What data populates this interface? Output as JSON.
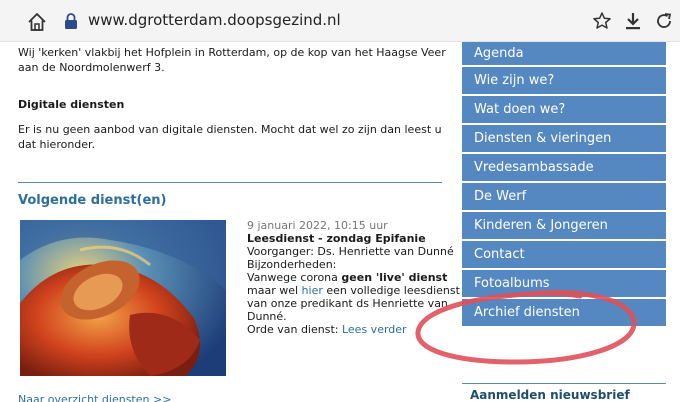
{
  "browser": {
    "url": "www.dgrotterdam.doopsgezind.nl"
  },
  "main": {
    "intro_text": "Wij 'kerken' vlakbij het Hofplein in Rotterdam, op de kop van het Haagse Veer aan de Noordmolenwerf 3.",
    "digital_title": "Digitale diensten",
    "digital_text": "Er is nu geen aanbod van digitale diensten. Mocht dat wel zo zijn dan leest u dat hieronder.",
    "next_title": "Volgende dienst(en)",
    "event": {
      "date": "9 januari 2022, 10:15 uur",
      "title": "Leesdienst - zondag Epifanie",
      "voorganger": "Voorganger: Ds. Henriette van Dunné",
      "bijzonderheden": "Bijzonderheden:",
      "line1_pre": "Vanwege corona ",
      "line1_bold": "geen 'live' dienst",
      "line2_pre": "maar wel ",
      "line2_link": "hier",
      "line2_post": " een volledige leesdienst",
      "line3": "van onze predikant ds Henriette van",
      "line4": "Dunné.",
      "order_pre": "Orde van dienst: ",
      "order_link": "Lees verder"
    },
    "overview_link": "Naar overzicht diensten >>"
  },
  "nav": {
    "items": [
      "Agenda",
      "Wie zijn we?",
      "Wat doen we?",
      "Diensten & vieringen",
      "Vredesambassade",
      "De Werf",
      "Kinderen & Jongeren",
      "Contact",
      "Fotoalbums",
      "Archief diensten"
    ]
  },
  "newsletter": {
    "title": "Aanmelden nieuwsbrief"
  },
  "colors": {
    "nav_bg": "#5588c0",
    "link": "#2e6f99",
    "annotation": "#e0505a"
  },
  "icons": [
    "home-icon",
    "lock-icon",
    "star-icon",
    "download-icon",
    "reload-icon"
  ]
}
